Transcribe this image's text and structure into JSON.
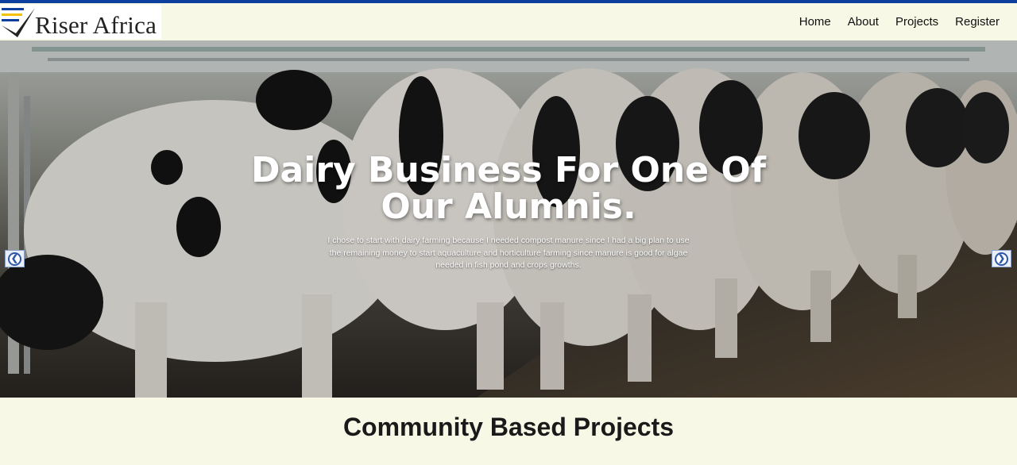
{
  "brand": {
    "name": "Riser Africa"
  },
  "nav": {
    "items": [
      {
        "label": "Home"
      },
      {
        "label": "About"
      },
      {
        "label": "Projects"
      },
      {
        "label": "Register"
      }
    ]
  },
  "hero": {
    "title": "Dairy Business For One Of Our Alumnis.",
    "text": "I chose to start with dairy farming because I needed compost manure since I had a big plan to use the remaining money to start aquaculture and horticulture farming since manure is good for algae needed in fish pond and crops growths.",
    "prev_icon": "chevron-left-icon",
    "next_icon": "chevron-right-icon"
  },
  "section": {
    "title": "Community Based Projects"
  },
  "colors": {
    "accent_bar": "#0d3f9f",
    "page_background": "#f8f8e6",
    "arrow_blue": "#2d57a8"
  }
}
